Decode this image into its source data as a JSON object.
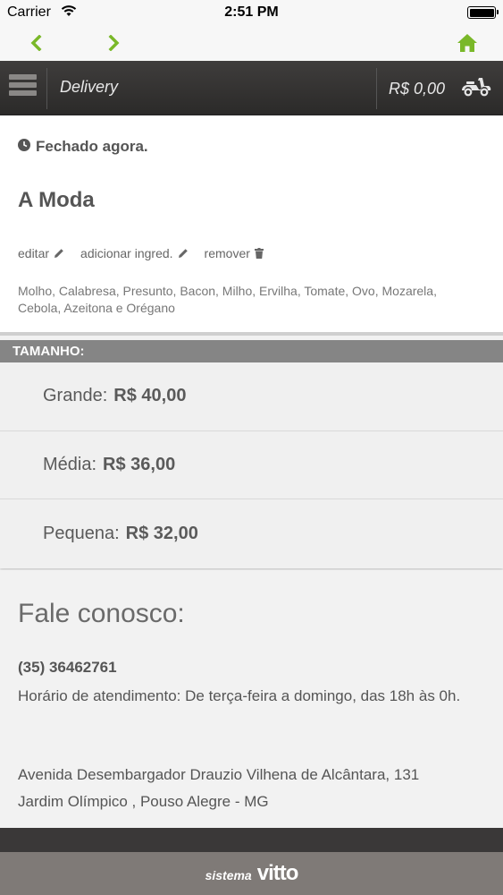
{
  "status_bar": {
    "carrier": "Carrier",
    "time": "2:51 PM"
  },
  "nav": {
    "icons": [
      "back-arrow-icon",
      "forward-arrow-icon",
      "home-icon"
    ],
    "accent": "#7ab829"
  },
  "header": {
    "title": "Delivery",
    "cart_total": "R$ 0,00"
  },
  "product": {
    "status": "Fechado agora.",
    "name": "A Moda",
    "actions": {
      "edit": "editar",
      "add_ingredient": "adicionar ingred.",
      "remove": "remover"
    },
    "ingredients": "Molho, Calabresa, Presunto, Bacon, Milho, Ervilha, Tomate, Ovo, Mozarela, Cebola, Azeitona e Orégano"
  },
  "sizes": {
    "label": "TAMANHO:",
    "options": [
      {
        "name": "Grande:",
        "price": "R$ 40,00"
      },
      {
        "name": "Média:",
        "price": "R$ 36,00"
      },
      {
        "name": "Pequena:",
        "price": "R$ 32,00"
      }
    ]
  },
  "contact": {
    "title": "Fale conosco:",
    "phone": "(35) 36462761",
    "hours": "Horário de atendimento: De terça-feira a domingo, das 18h às 0h.",
    "address_line1": "Avenida Desembargador Drauzio Vilhena de Alcântara, 131",
    "address_line2": "Jardim Olímpico , Pouso Alegre - MG"
  },
  "footer": {
    "prefix": "sistema",
    "brand": "vitto"
  }
}
